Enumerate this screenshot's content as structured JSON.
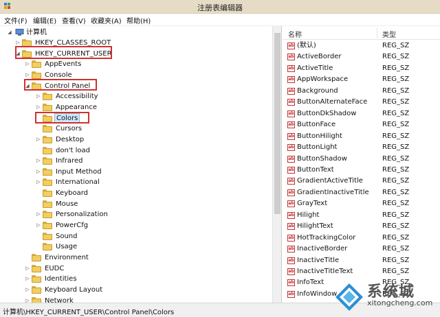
{
  "window": {
    "title": "注册表编辑器"
  },
  "menu": [
    "文件(F)",
    "编辑(E)",
    "查看(V)",
    "收藏夹(A)",
    "帮助(H)"
  ],
  "tree": {
    "root": "计算机",
    "nodes": [
      {
        "label": "HKEY_CLASSES_ROOT",
        "arrow": "▷"
      },
      {
        "label": "HKEY_CURRENT_USER",
        "arrow": "◢"
      },
      {
        "label": "AppEvents",
        "arrow": "▷"
      },
      {
        "label": "Console",
        "arrow": "▷"
      },
      {
        "label": "Control Panel",
        "arrow": "◢"
      },
      {
        "label": "Accessibility",
        "arrow": "▷"
      },
      {
        "label": "Appearance",
        "arrow": "▷"
      },
      {
        "label": "Colors",
        "arrow": ""
      },
      {
        "label": "Cursors",
        "arrow": ""
      },
      {
        "label": "Desktop",
        "arrow": "▷"
      },
      {
        "label": "don't load",
        "arrow": ""
      },
      {
        "label": "Infrared",
        "arrow": "▷"
      },
      {
        "label": "Input Method",
        "arrow": "▷"
      },
      {
        "label": "International",
        "arrow": "▷"
      },
      {
        "label": "Keyboard",
        "arrow": ""
      },
      {
        "label": "Mouse",
        "arrow": ""
      },
      {
        "label": "Personalization",
        "arrow": "▷"
      },
      {
        "label": "PowerCfg",
        "arrow": "▷"
      },
      {
        "label": "Sound",
        "arrow": ""
      },
      {
        "label": "Usage",
        "arrow": ""
      },
      {
        "label": "Environment",
        "arrow": ""
      },
      {
        "label": "EUDC",
        "arrow": "▷"
      },
      {
        "label": "Identities",
        "arrow": "▷"
      },
      {
        "label": "Keyboard Layout",
        "arrow": "▷"
      },
      {
        "label": "Network",
        "arrow": "▷"
      }
    ],
    "selected": "Colors"
  },
  "list": {
    "headers": {
      "name": "名称",
      "type": "类型"
    },
    "rows": [
      {
        "name": "(默认)",
        "type": "REG_SZ"
      },
      {
        "name": "ActiveBorder",
        "type": "REG_SZ"
      },
      {
        "name": "ActiveTitle",
        "type": "REG_SZ"
      },
      {
        "name": "AppWorkspace",
        "type": "REG_SZ"
      },
      {
        "name": "Background",
        "type": "REG_SZ"
      },
      {
        "name": "ButtonAlternateFace",
        "type": "REG_SZ"
      },
      {
        "name": "ButtonDkShadow",
        "type": "REG_SZ"
      },
      {
        "name": "ButtonFace",
        "type": "REG_SZ"
      },
      {
        "name": "ButtonHilight",
        "type": "REG_SZ"
      },
      {
        "name": "ButtonLight",
        "type": "REG_SZ"
      },
      {
        "name": "ButtonShadow",
        "type": "REG_SZ"
      },
      {
        "name": "ButtonText",
        "type": "REG_SZ"
      },
      {
        "name": "GradientActiveTitle",
        "type": "REG_SZ"
      },
      {
        "name": "GradientInactiveTitle",
        "type": "REG_SZ"
      },
      {
        "name": "GrayText",
        "type": "REG_SZ"
      },
      {
        "name": "Hilight",
        "type": "REG_SZ"
      },
      {
        "name": "HilightText",
        "type": "REG_SZ"
      },
      {
        "name": "HotTrackingColor",
        "type": "REG_SZ"
      },
      {
        "name": "InactiveBorder",
        "type": "REG_SZ"
      },
      {
        "name": "InactiveTitle",
        "type": "REG_SZ"
      },
      {
        "name": "InactiveTitleText",
        "type": "REG_SZ"
      },
      {
        "name": "InfoText",
        "type": "REG_SZ"
      },
      {
        "name": "InfoWindow",
        "type": "REG_SZ"
      }
    ],
    "icon": "string-value-icon",
    "icon_text": "ab"
  },
  "status": {
    "path": "计算机\\HKEY_CURRENT_USER\\Control Panel\\Colors"
  },
  "watermark": {
    "name": "系统城",
    "url": "xitongcheng.com"
  },
  "colors": {
    "titlebar": "#e6dcc6",
    "highlight_box": "#d0302f",
    "selection": "#cce8ff",
    "folder": "#f2cd5f"
  }
}
